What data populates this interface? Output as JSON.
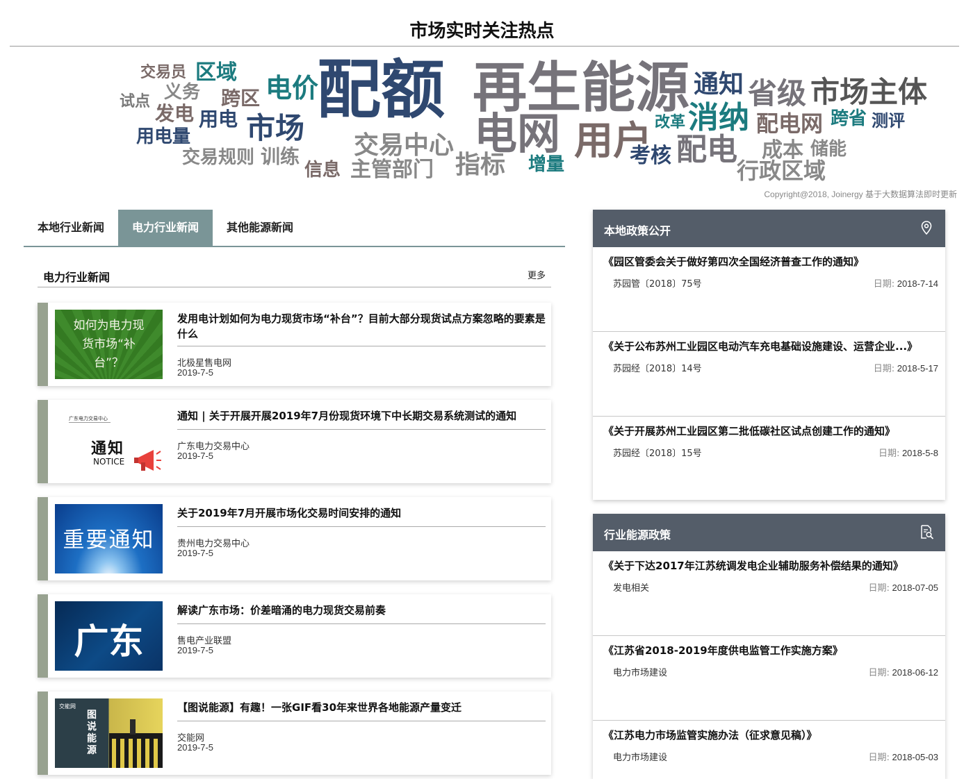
{
  "page_title": "市场实时关注热点",
  "word_cloud": [
    {
      "text": "交易员",
      "color": "#7a6a68",
      "size": 22
    },
    {
      "text": "区域",
      "color": "#1c7b7f",
      "size": 30
    },
    {
      "text": "配额",
      "color": "#2f4870",
      "size": 92
    },
    {
      "text": "再生能源",
      "color": "#76737a",
      "size": 78
    },
    {
      "text": "通知",
      "color": "#2f4870",
      "size": 36
    },
    {
      "text": "省级",
      "color": "#76737a",
      "size": 42
    },
    {
      "text": "市场主体",
      "color": "#555",
      "size": 42
    },
    {
      "text": "试点",
      "color": "#7a7a7a",
      "size": 22
    },
    {
      "text": "义务",
      "color": "#888",
      "size": 26
    },
    {
      "text": "跨区",
      "color": "#7a6a68",
      "size": 28
    },
    {
      "text": "电价",
      "color": "#1c7b7f",
      "size": 38
    },
    {
      "text": "发电",
      "color": "#7a6a68",
      "size": 28
    },
    {
      "text": "用电",
      "color": "#2f4870",
      "size": 28
    },
    {
      "text": "市场",
      "color": "#2f4870",
      "size": 42
    },
    {
      "text": "电网",
      "color": "#76737a",
      "size": 62
    },
    {
      "text": "消纳",
      "color": "#1c7b7f",
      "size": 44
    },
    {
      "text": "改革",
      "color": "#1c7b7f",
      "size": 22
    },
    {
      "text": "配电网",
      "color": "#7a6a68",
      "size": 32
    },
    {
      "text": "跨省",
      "color": "#1c7b7f",
      "size": 26
    },
    {
      "text": "测评",
      "color": "#2f4870",
      "size": 24
    },
    {
      "text": "用电量",
      "color": "#2f4870",
      "size": 26
    },
    {
      "text": "交易中心",
      "color": "#888",
      "size": 36
    },
    {
      "text": "用户",
      "color": "#7a6a68",
      "size": 56
    },
    {
      "text": "配电",
      "color": "#76737a",
      "size": 44
    },
    {
      "text": "成本",
      "color": "#888",
      "size": 30
    },
    {
      "text": "储能",
      "color": "#888",
      "size": 26
    },
    {
      "text": "交易规则",
      "color": "#888",
      "size": 26
    },
    {
      "text": "训练",
      "color": "#888",
      "size": 28
    },
    {
      "text": "考核",
      "color": "#2f4870",
      "size": 30
    },
    {
      "text": "信息",
      "color": "#7a6a68",
      "size": 26
    },
    {
      "text": "主管部门",
      "color": "#888",
      "size": 30
    },
    {
      "text": "指标",
      "color": "#888",
      "size": 36
    },
    {
      "text": "增量",
      "color": "#1c7b7f",
      "size": 26
    },
    {
      "text": "行政区域",
      "color": "#888",
      "size": 32
    }
  ],
  "copyright": "Copyright@2018, Joinergy 基于大数据算法即时更新",
  "tabs": [
    {
      "label": "本地行业新闻",
      "active": false
    },
    {
      "label": "电力行业新闻",
      "active": true
    },
    {
      "label": "其他能源新闻",
      "active": false
    }
  ],
  "news_section": {
    "title": "电力行业新闻",
    "more": "更多",
    "items": [
      {
        "title": "发用电计划如何为电力现货市场“补台”？目前大部分现货试点方案忽略的要素是什么",
        "source": "北极星售电网",
        "date": "2019-7-5",
        "thumb_text": "如何为电力现货市场“补台”？",
        "thumb_type": "green"
      },
      {
        "title": "通知 | 关于开展开展2019年7月份现货环境下中长期交易系统测试的通知",
        "source": "广东电力交易中心",
        "date": "2019-7-5",
        "thumb_text": "通知",
        "thumb_sub": "NOTICE",
        "thumb_org": "广东电力交易中心",
        "thumb_type": "notice"
      },
      {
        "title": "关于2019年7月开展市场化交易时间安排的通知",
        "source": "贵州电力交易中心",
        "date": "2019-7-5",
        "thumb_text": "重要通知",
        "thumb_type": "blue"
      },
      {
        "title": "解读广东市场：价差暗涌的电力现货交易前奏",
        "source": "售电产业联盟",
        "date": "2019-7-5",
        "thumb_text": "广东",
        "thumb_type": "dark"
      },
      {
        "title": "【图说能源】有趣！一张GIF看30年来世界各地能源产量变迁",
        "source": "交能网",
        "date": "2019-7-5",
        "thumb_text": "图说能源",
        "thumb_brand": "交能网",
        "thumb_type": "energy"
      }
    ]
  },
  "local_policy": {
    "title": "本地政策公开",
    "icon": "location-pin-icon",
    "date_label": "日期:",
    "items": [
      {
        "title": "《园区管委会关于做好第四次全国经济普查工作的通知》",
        "number": "苏园管〔2018〕75号",
        "date": "2018-7-14"
      },
      {
        "title": "《关于公布苏州工业园区电动汽车充电基础设施建设、运营企业...》",
        "number": "苏园经〔2018〕14号",
        "date": "2018-5-17"
      },
      {
        "title": "《关于开展苏州工业园区第二批低碳社区试点创建工作的通知》",
        "number": "苏园经〔2018〕15号",
        "date": "2018-5-8"
      }
    ]
  },
  "industry_policy": {
    "title": "行业能源政策",
    "icon": "document-search-icon",
    "date_label": "日期:",
    "items": [
      {
        "title": "《关于下达2017年江苏统调发电企业辅助服务补偿结果的通知》",
        "category": "发电相关",
        "date": "2018-07-05"
      },
      {
        "title": "《江苏省2018-2019年度供电监管工作实施方案》",
        "category": "电力市场建设",
        "date": "2018-06-12"
      },
      {
        "title": "《江苏电力市场监管实施办法（征求意见稿）》",
        "category": "电力市场建设",
        "date": "2018-05-03"
      }
    ]
  }
}
